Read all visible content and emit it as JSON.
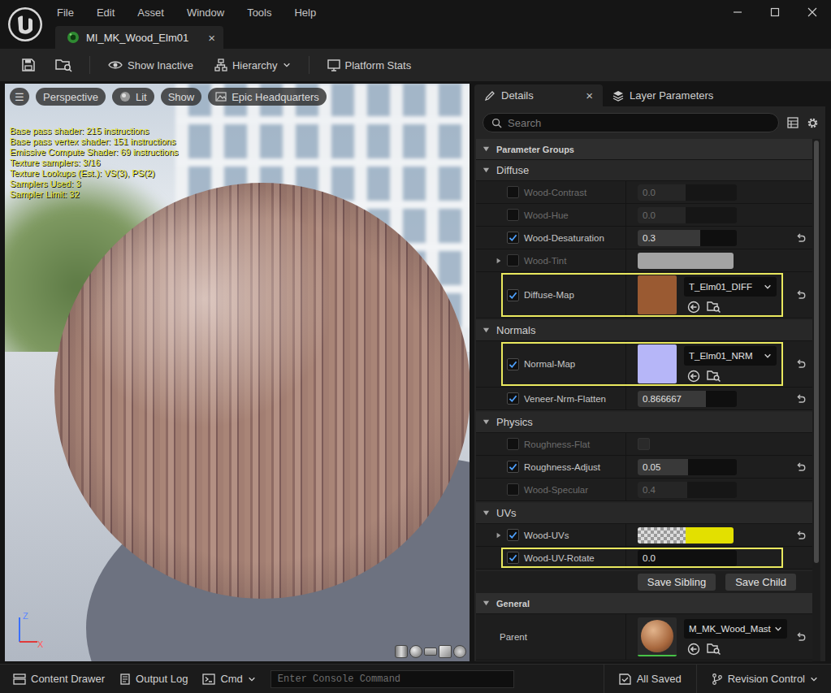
{
  "window": {
    "tab": {
      "title": "MI_MK_Wood_Elm01",
      "close": "×",
      "selected": true
    }
  },
  "menu": [
    "File",
    "Edit",
    "Asset",
    "Window",
    "Tools",
    "Help"
  ],
  "toolbar": [
    {
      "label": "Show Inactive",
      "dropdown": false
    },
    {
      "label": "Hierarchy",
      "dropdown": true
    },
    {
      "label": "Platform Stats",
      "dropdown": false
    }
  ],
  "viewport": {
    "menu": "☰",
    "chips": [
      {
        "label": "Perspective",
        "kind": "plain"
      },
      {
        "label": "Lit",
        "kind": "icon"
      },
      {
        "label": "Show",
        "kind": "plain"
      },
      {
        "label": "Epic Headquarters",
        "kind": "icon"
      }
    ],
    "stats": [
      "Base pass shader: 215 instructions",
      "Base pass vertex shader: 151 instructions",
      "Emissive Compute Shader: 69 instructions",
      "Texture samplers: 3/16",
      "Texture Lookups (Est.): VS(3), PS(2)",
      "Samplers Used: 3",
      "Sampler Limit: 32"
    ],
    "axes": {
      "up": "Z",
      "side": "X"
    }
  },
  "details": {
    "tabs": [
      {
        "label": "Details",
        "selected": true,
        "close": "×"
      },
      {
        "label": "Layer Parameters",
        "selected": false,
        "close": ""
      }
    ],
    "search_placeholder": "Search",
    "groups_header": {
      "title": "Parameter Groups",
      "expanded": true
    },
    "groups": [
      {
        "title": "Diffuse",
        "expanded": true,
        "params": [
          {
            "name": "Wood-Contrast",
            "kind": "scalar",
            "enabled": false,
            "value": "0.0",
            "level": 0.48,
            "resettable": false,
            "highlighted": false,
            "expandable": false,
            "expanded": false
          },
          {
            "name": "Wood-Hue",
            "kind": "scalar",
            "enabled": false,
            "value": "0.0",
            "level": 0.48,
            "resettable": false,
            "highlighted": false,
            "expandable": false,
            "expanded": false
          },
          {
            "name": "Wood-Desaturation",
            "kind": "scalar",
            "enabled": true,
            "value": "0.3",
            "level": 0.63,
            "resettable": true,
            "highlighted": false,
            "expandable": false,
            "expanded": false
          },
          {
            "name": "Wood-Tint",
            "kind": "vector",
            "enabled": false,
            "color": "#a3a3a3",
            "alpha_preview": false,
            "resettable": false,
            "highlighted": false,
            "expandable": true,
            "expanded": false
          },
          {
            "name": "Diffuse-Map",
            "kind": "texture",
            "enabled": true,
            "asset": "T_Elm01_DIFF",
            "color": "#9a5a32",
            "resettable": true,
            "highlighted": true,
            "expandable": false,
            "expanded": false
          }
        ]
      },
      {
        "title": "Normals",
        "expanded": true,
        "params": [
          {
            "name": "Normal-Map",
            "kind": "texture",
            "enabled": true,
            "asset": "T_Elm01_NRM",
            "color": "#b6b6f8",
            "resettable": true,
            "highlighted": true,
            "expandable": false,
            "expanded": false
          },
          {
            "name": "Veneer-Nrm-Flatten",
            "kind": "scalar",
            "enabled": true,
            "value": "0.866667",
            "level": 0.69,
            "resettable": true,
            "highlighted": false,
            "expandable": false,
            "expanded": false
          }
        ]
      },
      {
        "title": "Physics",
        "expanded": true,
        "params": [
          {
            "name": "Roughness-Flat",
            "kind": "bool",
            "enabled": false,
            "on": false,
            "resettable": false,
            "highlighted": false,
            "expandable": false,
            "expanded": false
          },
          {
            "name": "Roughness-Adjust",
            "kind": "scalar",
            "enabled": true,
            "value": "0.05",
            "level": 0.51,
            "resettable": true,
            "highlighted": false,
            "expandable": false,
            "expanded": false
          },
          {
            "name": "Wood-Specular",
            "kind": "scalar",
            "enabled": false,
            "value": "0.4",
            "level": 0.5,
            "resettable": false,
            "highlighted": false,
            "expandable": false,
            "expanded": false
          }
        ]
      },
      {
        "title": "UVs",
        "expanded": true,
        "params": [
          {
            "name": "Wood-UVs",
            "kind": "vector",
            "enabled": true,
            "color": "#e3e000",
            "alpha_preview": true,
            "resettable": true,
            "highlighted": false,
            "expandable": true,
            "expanded": false
          },
          {
            "name": "Wood-UV-Rotate",
            "kind": "scalar",
            "enabled": true,
            "value": "0.0",
            "level": 0,
            "resettable": false,
            "highlighted": true,
            "expandable": false,
            "expanded": false
          }
        ]
      }
    ],
    "buttons": [
      "Save Sibling",
      "Save Child"
    ],
    "general": {
      "title": "General",
      "expanded": true,
      "parent": {
        "label": "Parent",
        "asset": "M_MK_Wood_Mast",
        "resettable": true
      }
    }
  },
  "status_bar": {
    "left": [
      {
        "label": "Content Drawer",
        "dropdown": false
      },
      {
        "label": "Output Log",
        "dropdown": false
      },
      {
        "label": "Cmd",
        "dropdown": true
      }
    ],
    "console_placeholder": "Enter Console Command",
    "right": [
      {
        "label": "All Saved",
        "dropdown": false
      },
      {
        "label": "Revision Control",
        "dropdown": true
      }
    ]
  }
}
